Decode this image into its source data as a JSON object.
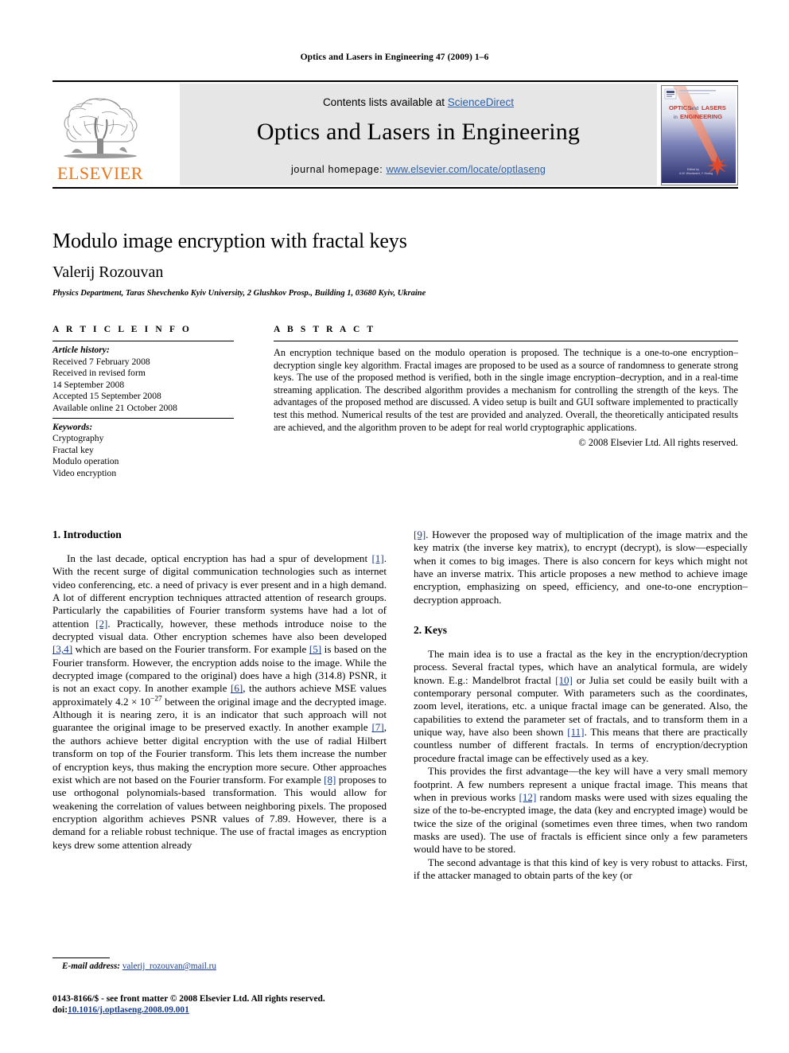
{
  "running_head": "Optics and Lasers in Engineering 47 (2009) 1–6",
  "masthead": {
    "contents_prefix": "Contents lists available at ",
    "sciencedirect": "ScienceDirect",
    "journal_title": "Optics and Lasers in Engineering",
    "homepage_prefix": "journal homepage: ",
    "homepage_url": "www.elsevier.com/locate/optlaseng",
    "publisher_wordmark": "ELSEVIER",
    "publisher_color": "#e8761a",
    "link_color": "#2b5fa8",
    "band_color": "#e6e6e6",
    "cover": {
      "line1": "OPTICS and LASERS",
      "line2": "in ENGINEERING",
      "footer1": "Edited by",
      "footer2": "A.W. Woodward, Y. Huang"
    }
  },
  "article": {
    "title": "Modulo image encryption with fractal keys",
    "author": "Valerij Rozouvan",
    "affiliation": "Physics Department, Taras Shevchenko Kyiv University, 2 Glushkov Prosp., Building 1, 03680 Kyiv, Ukraine"
  },
  "article_info": {
    "heading": "A R T I C L E   I N F O",
    "history_label": "Article history:",
    "history": [
      "Received 7 February 2008",
      "Received in revised form",
      "14 September 2008",
      "Accepted 15 September 2008",
      "Available online 21 October 2008"
    ],
    "keywords_label": "Keywords:",
    "keywords": [
      "Cryptography",
      "Fractal key",
      "Modulo operation",
      "Video encryption"
    ]
  },
  "abstract": {
    "heading": "A B S T R A C T",
    "text": "An encryption technique based on the modulo operation is proposed. The technique is a one-to-one encryption–decryption single key algorithm. Fractal images are proposed to be used as a source of randomness to generate strong keys. The use of the proposed method is verified, both in the single image encryption–decryption, and in a real-time streaming application. The described algorithm provides a mechanism for controlling the strength of the keys. The advantages of the proposed method are discussed. A video setup is built and GUI software implemented to practically test this method. Numerical results of the test are provided and analyzed. Overall, the theoretically anticipated results are achieved, and the algorithm proven to be adept for real world cryptographic applications.",
    "copyright": "© 2008 Elsevier Ltd. All rights reserved."
  },
  "sections": {
    "introduction_heading": "1.  Introduction",
    "keys_heading": "2.  Keys"
  },
  "body": {
    "intro_p1_a": "In the last decade, optical encryption has had a spur of development ",
    "intro_p1_ref1": "[1]",
    "intro_p1_b": ". With the recent surge of digital communication technologies such as internet video conferencing, etc. a need of privacy is ever present and in a high demand. A lot of different encryption techniques attracted attention of research groups. Particularly the capabilities of Fourier transform systems have had a lot of attention ",
    "intro_p1_ref2": "[2]",
    "intro_p1_c": ". Practically, however, these methods introduce noise to the decrypted visual data. Other encryption schemes have also been developed ",
    "intro_p1_ref34": "[3,4]",
    "intro_p1_d": " which are based on the Fourier transform. For example ",
    "intro_p1_ref5": "[5]",
    "intro_p1_e": " is based on the Fourier transform. However, the encryption adds noise to the image. While the decrypted image (compared to the original) does have a high (314.8) PSNR, it is not an exact copy. In another example ",
    "intro_p1_ref6": "[6]",
    "intro_p1_f": ", the authors achieve MSE values approximately 4.2 × 10",
    "intro_p1_exp": "−27",
    "intro_p1_g": " between the original image and the decrypted image. Although it is nearing zero, it is an indicator that such approach will not guarantee the original image to be preserved exactly. In another example ",
    "intro_p1_ref7": "[7]",
    "intro_p1_h": ", the authors achieve better digital encryption with the use of radial Hilbert transform on top of the Fourier transform. This lets them increase the number of encryption keys, thus making the encryption more secure. Other approaches exist which are not based on the Fourier transform. For example ",
    "intro_p1_ref8": "[8]",
    "intro_p1_i": " proposes to use orthogonal polynomials-based transformation. This would allow for weakening the correlation of values between neighboring pixels. The proposed encryption algorithm achieves PSNR values of 7.89. However, there is a demand for a reliable robust technique. The use of fractal images as encryption keys drew some attention already ",
    "intro_p1_ref9": "[9]",
    "intro_p1_j": ". However the proposed way of multiplication of the image matrix and the key matrix (the inverse key matrix), to encrypt (decrypt), is slow—especially when it comes to big images. There is also concern for keys which might not have an inverse matrix. This article proposes a new method to achieve image encryption, emphasizing on speed, efficiency, and one-to-one encryption–decryption approach.",
    "keys_p1_a": "The main idea is to use a fractal as the key in the encryption/decryption process. Several fractal types, which have an analytical formula, are widely known. E.g.: Mandelbrot fractal ",
    "keys_p1_ref10": "[10]",
    "keys_p1_b": " or Julia set could be easily built with a contemporary personal computer. With parameters such as the coordinates, zoom level, iterations, etc. a unique fractal image can be generated. Also, the capabilities to extend the parameter set of fractals, and to transform them in a unique way, have also been shown ",
    "keys_p1_ref11": "[11]",
    "keys_p1_c": ". This means that there are practically countless number of different fractals. In terms of encryption/decryption procedure fractal image can be effectively used as a key.",
    "keys_p2_a": "This provides the first advantage—the key will have a very small memory footprint. A few numbers represent a unique fractal image. This means that when in previous works ",
    "keys_p2_ref12": "[12]",
    "keys_p2_b": " random masks were used with sizes equaling the size of the to-be-encrypted image, the data (key and encrypted image) would be twice the size of the original (sometimes even three times, when two random masks are used). The use of fractals is efficient since only a few parameters would have to be stored.",
    "keys_p3": "The second advantage is that this kind of key is very robust to attacks. First, if the attacker managed to obtain parts of the key (or"
  },
  "footer": {
    "email_label": "E-mail address:",
    "email": "valerij_rozouvan@mail.ru",
    "issn_line": "0143-8166/$ - see front matter © 2008 Elsevier Ltd. All rights reserved.",
    "doi_label": "doi:",
    "doi": "10.1016/j.optlaseng.2008.09.001"
  }
}
